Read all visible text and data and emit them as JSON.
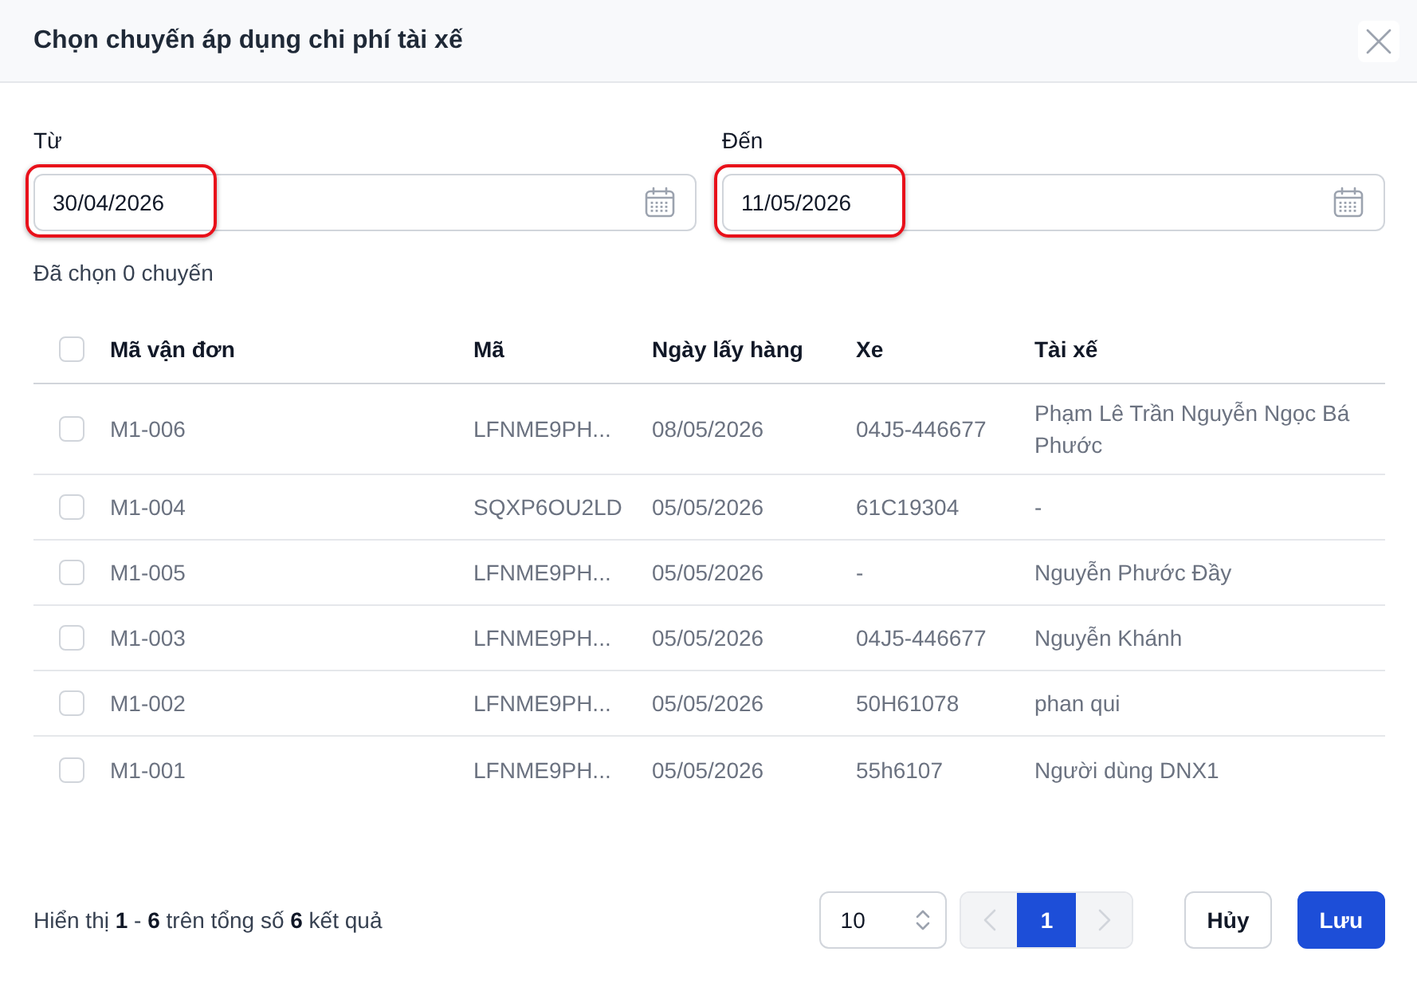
{
  "dialog": {
    "title": "Chọn chuyến áp dụng chi phí tài xế"
  },
  "filters": [
    {
      "label": "Từ",
      "value": "30/04/2026",
      "highlighted": true
    },
    {
      "label": "Đến",
      "value": "11/05/2026",
      "highlighted": true
    }
  ],
  "selection_summary": "Đã chọn 0 chuyến",
  "table": {
    "select_all_checked": false,
    "columns": [
      "Mã vận đơn",
      "Mã",
      "Ngày lấy hàng",
      "Xe",
      "Tài xế"
    ],
    "rows": [
      {
        "checked": false,
        "cells": [
          "M1-006",
          "LFNME9PH...",
          "08/05/2026",
          "04J5-446677",
          "Phạm Lê Trần Nguyễn Ngọc Bá Phước"
        ]
      },
      {
        "checked": false,
        "cells": [
          "M1-004",
          "SQXP6OU2LD",
          "05/05/2026",
          "61C19304",
          "-"
        ]
      },
      {
        "checked": false,
        "cells": [
          "M1-005",
          "LFNME9PH...",
          "05/05/2026",
          "-",
          "Nguyễn Phước Đầy"
        ]
      },
      {
        "checked": false,
        "cells": [
          "M1-003",
          "LFNME9PH...",
          "05/05/2026",
          "04J5-446677",
          "Nguyễn Khánh"
        ]
      },
      {
        "checked": false,
        "cells": [
          "M1-002",
          "LFNME9PH...",
          "05/05/2026",
          "50H61078",
          "phan qui"
        ]
      },
      {
        "checked": false,
        "cells": [
          "M1-001",
          "LFNME9PH...",
          "05/05/2026",
          "55h6107",
          "Người dùng DNX1"
        ]
      }
    ]
  },
  "footer": {
    "summary": "Hiển thị **1** - **6** trên tổng số **6** kết quả",
    "page_size": "10",
    "pagination": {
      "prev_disabled": true,
      "next_disabled": true,
      "pages": [
        {
          "label": "1",
          "selected": true
        }
      ]
    },
    "buttons": [
      {
        "label": "Hủy",
        "kind": "secondary"
      },
      {
        "label": "Lưu",
        "kind": "primary"
      }
    ]
  }
}
